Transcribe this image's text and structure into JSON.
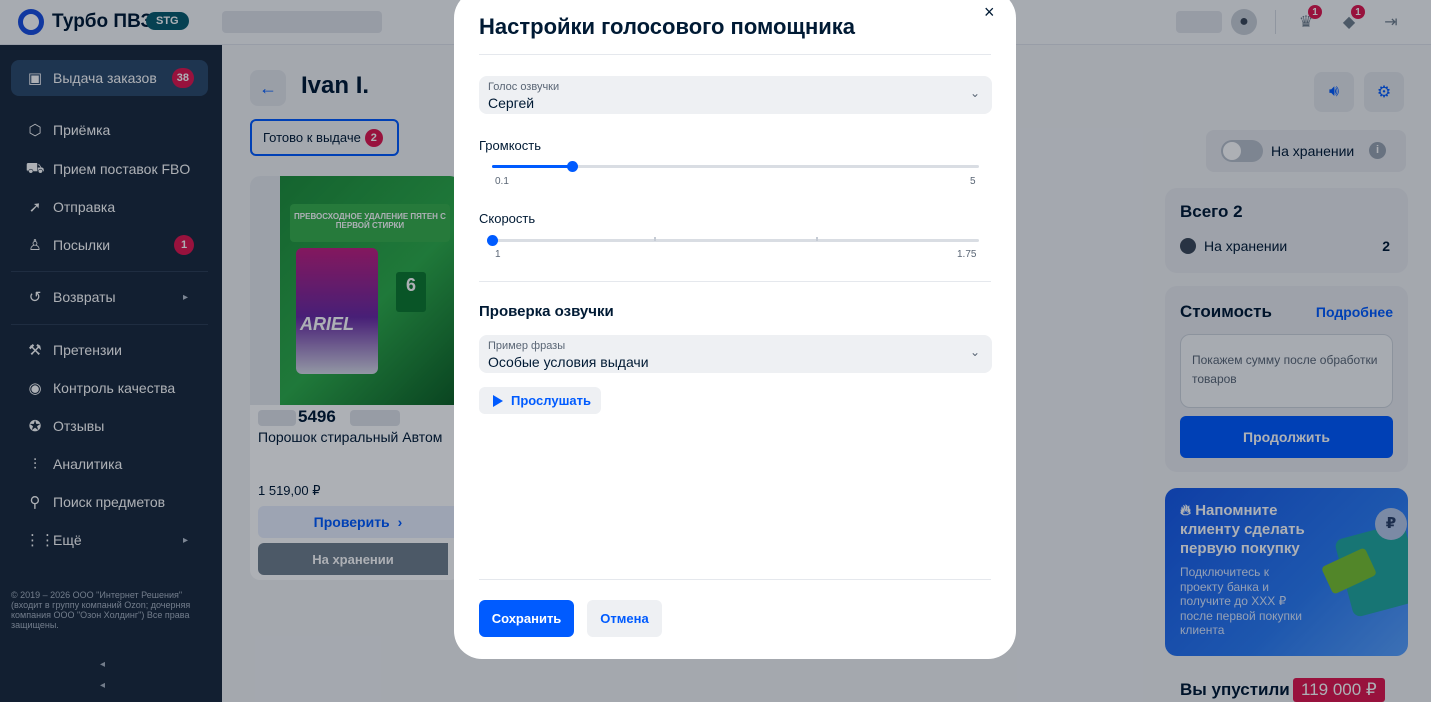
{
  "app": {
    "title": "Турбо ПВЗ",
    "env_badge": "STG"
  },
  "topbar": {
    "icons": [
      {
        "name": "user-icon",
        "glyph": "●"
      },
      {
        "name": "hat-icon",
        "glyph": "♛",
        "badge": "1"
      },
      {
        "name": "bell-icon",
        "glyph": "◆",
        "badge": "1"
      },
      {
        "name": "logout-icon",
        "glyph": "⇥"
      }
    ]
  },
  "sidebar": {
    "items": [
      {
        "label": "Выдача заказов",
        "icon": "box-icon",
        "glyph": "▣",
        "badge": "38"
      },
      {
        "label": "Приёмка",
        "icon": "package-icon",
        "glyph": "⬡"
      },
      {
        "label": "Прием поставок FBO",
        "icon": "truck-icon",
        "glyph": "⛟"
      },
      {
        "label": "Отправка",
        "icon": "send-icon",
        "glyph": "➚"
      },
      {
        "label": "Посылки",
        "icon": "person-icon",
        "glyph": "♙",
        "badge": "1"
      },
      {
        "label": "Возвраты",
        "icon": "return-icon",
        "glyph": "↺",
        "arrow": "▸"
      },
      {
        "label": "Претензии",
        "icon": "hammer-icon",
        "glyph": "⚒"
      },
      {
        "label": "Контроль качества",
        "icon": "eye-icon",
        "glyph": "◉"
      },
      {
        "label": "Отзывы",
        "icon": "star-chat-icon",
        "glyph": "✪"
      },
      {
        "label": "Аналитика",
        "icon": "chart-icon",
        "glyph": "⫶"
      },
      {
        "label": "Поиск предметов",
        "icon": "search-icon",
        "glyph": "⚲"
      },
      {
        "label": "Ещё",
        "icon": "dots-icon",
        "glyph": "⋮⋮",
        "arrow": "▸"
      }
    ],
    "footer": "© 2019 – 2026 ООО \"Интернет Решения\" (входит в группу компаний Ozon; дочерняя компания ООО \"Озон Холдинг\") Все права защищены."
  },
  "main": {
    "client_name": "Ivan I.",
    "status_chip": {
      "label": "Готово к выдаче",
      "count": "2"
    },
    "card": {
      "promo_text": "ПРЕВОСХОДНОЕ УДАЛЕНИЕ ПЯТЕН С ПЕРВОЙ СТИРКИ",
      "brand": "ARIEL",
      "pack_weight": "6",
      "code": "5496",
      "title": "Порошок стиральный Автом",
      "price": "1 519,00 ₽",
      "check_label": "Проверить",
      "store_label": "На хранении"
    }
  },
  "right": {
    "toggle_label": "На хранении",
    "total": {
      "title": "Всего 2",
      "row_label": "На хранении",
      "row_value": "2"
    },
    "cost": {
      "title": "Стоимость",
      "more": "Подробнее",
      "placeholder": "Покажем сумму после обработки товаров",
      "continue": "Продолжить"
    },
    "promo": {
      "title": "Напомните клиенту сделать первую покупку",
      "text": "Подключитесь к проекту банка и получите до ХХХ ₽ после первой покупки клиента",
      "coin": "₽"
    },
    "missed": {
      "label": "Вы упустили",
      "value": "119 000 ₽"
    }
  },
  "modal": {
    "title": "Настройки голосового помощника",
    "close": "×",
    "voice": {
      "label": "Голос озвучки",
      "value": "Сергей"
    },
    "volume": {
      "label": "Громкость",
      "min": "0.1",
      "max": "5",
      "value": 0.9
    },
    "speed": {
      "label": "Скорость",
      "min": "1",
      "max": "1.75",
      "value": 1
    },
    "check_section": "Проверка озвучки",
    "phrase": {
      "label": "Пример фразы",
      "value": "Особые условия выдачи"
    },
    "listen": "Прослушать",
    "save": "Сохранить",
    "cancel": "Отмена"
  }
}
